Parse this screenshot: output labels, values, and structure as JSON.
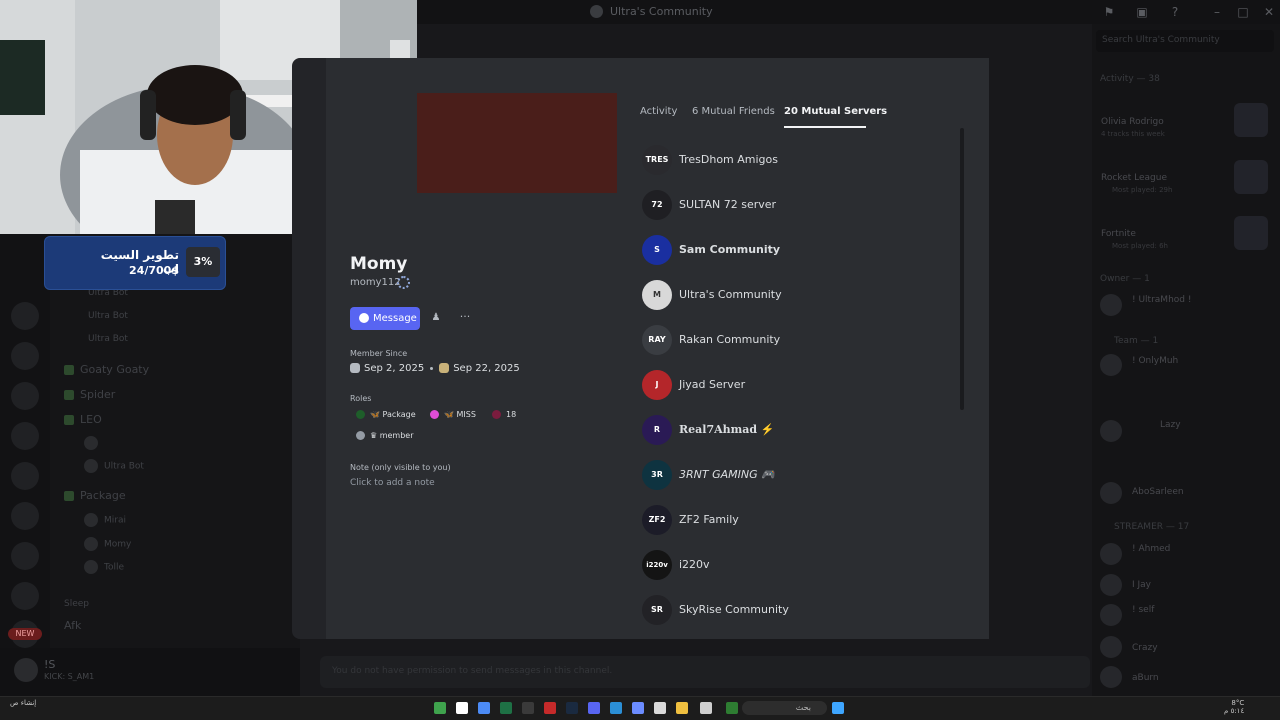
{
  "window": {
    "title": "Ultra's Community"
  },
  "server": {
    "search_placeholder": "Search Ultra's Community"
  },
  "stream_overlay": {
    "goal_title": "تطوير السيت اب",
    "goal_amount": "24/700$",
    "goal_percent": "3%"
  },
  "channels": {
    "items": [
      "Ultra Bot",
      "Ultra Bot",
      "Ultra Bot",
      "Goaty Goaty",
      "Spider",
      "LEO",
      "Package",
      "Sleep",
      "Afk"
    ],
    "users": [
      "Ultra Bot",
      "Mirai",
      "Momy",
      "Tolle"
    ],
    "new_badge": "NEW",
    "current_user": "!S",
    "current_user_status": "KICK: S_AM1"
  },
  "chat": {
    "placeholder": "You do not have permission to send messages in this channel."
  },
  "profile": {
    "display_name": "Momy",
    "username": "momy112",
    "message_button": "Message",
    "member_since_label": "Member Since",
    "member_since_discord": "Sep 2, 2025",
    "member_since_server": "Sep 22, 2025",
    "roles_label": "Roles",
    "roles": [
      {
        "name": "Package",
        "color": "#1e5e2a"
      },
      {
        "name": "MISS",
        "color": "#e04dd7"
      },
      {
        "name": "18",
        "color": "#7a1c3e"
      },
      {
        "name": "member",
        "color": "#949ba4"
      }
    ],
    "note_label": "Note (only visible to you)",
    "note_placeholder": "Click to add a note"
  },
  "tabs": [
    {
      "label": "Activity"
    },
    {
      "label": "6 Mutual Friends"
    },
    {
      "label": "20 Mutual Servers"
    }
  ],
  "mutual_servers": [
    {
      "name": "TresDhom Amigos",
      "icon": "TRES",
      "color": "#2a2a2e"
    },
    {
      "name": "SULTAN 72 server",
      "icon": "72",
      "color": "#1f1f23"
    },
    {
      "name": "Sam Community",
      "icon": "S",
      "color": "#1a2fa0"
    },
    {
      "name": "Ultra's Community",
      "icon": "M",
      "color": "#d8d8d8"
    },
    {
      "name": "Rakan Community",
      "icon": "RAY",
      "color": "#3a3d42"
    },
    {
      "name": "Jiyad Server",
      "icon": "J",
      "color": "#b4262a"
    },
    {
      "name": "Real7Ahmad ⚡",
      "icon": "R",
      "color": "#2a1a55"
    },
    {
      "name": "3RNT GAMING 🎮",
      "icon": "3R",
      "color": "#0e3340"
    },
    {
      "name": "ZF2 Family",
      "icon": "ZF2",
      "color": "#1c1c28"
    },
    {
      "name": "i220v",
      "icon": "i220v",
      "color": "#141414"
    },
    {
      "name": "SkyRise Community",
      "icon": "SR",
      "color": "#222226"
    }
  ],
  "members": {
    "activity_header": "Activity — 38",
    "activity": [
      {
        "name": "Olivia Rodrigo",
        "detail": "4 tracks this week"
      },
      {
        "name": "Rocket League",
        "detail": "Most played: 29h"
      },
      {
        "name": "Fortnite",
        "detail": "Most played: 6h"
      }
    ],
    "groups": [
      "Owner — 1",
      "Team — 1",
      "STREAMER — 17"
    ],
    "names": [
      "! UltraMhod !",
      "! OnlyMuh",
      "Lazy",
      "AboSarleen",
      "! Ahmed",
      "I Jay",
      "! self",
      "Crazy",
      "aBurn"
    ]
  },
  "taskbar": {
    "search_text": "بحث",
    "time": "٥:١٤ م",
    "date": "٢٠٢٥/٩/٢٧",
    "weather": "8°C",
    "left_info": "إنشاء ص"
  }
}
